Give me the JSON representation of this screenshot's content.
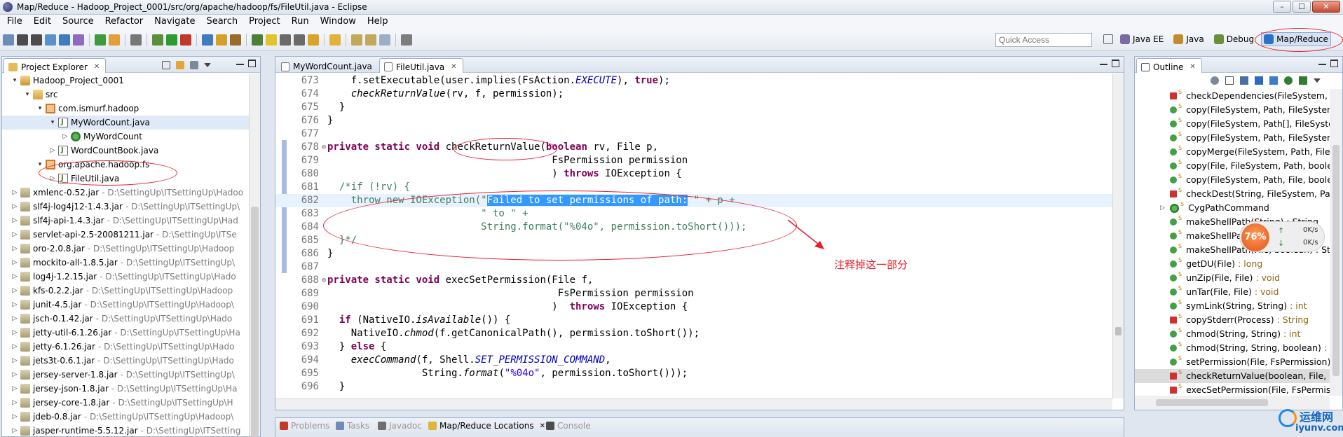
{
  "window": {
    "title": "Map/Reduce - Hadoop_Project_0001/src/org/apache/hadoop/fs/FileUtil.java - Eclipse"
  },
  "menu": [
    "File",
    "Edit",
    "Source",
    "Refactor",
    "Navigate",
    "Search",
    "Project",
    "Run",
    "Window",
    "Help"
  ],
  "toolbar": {
    "quick_access_placeholder": "Quick Access",
    "perspectives": [
      "Java EE",
      "Java",
      "Debug",
      "Map/Reduce"
    ],
    "active_perspective": "Map/Reduce"
  },
  "explorer": {
    "tab": "Project Explorer",
    "nodes": [
      {
        "label": "Hadoop_Project_0001",
        "path": "",
        "indent": 1,
        "arrow": "▾",
        "icon": "project-icon"
      },
      {
        "label": "src",
        "path": "",
        "indent": 2,
        "arrow": "▾",
        "icon": "folder-icon"
      },
      {
        "label": "com.ismurf.hadoop",
        "path": "",
        "indent": 3,
        "arrow": "▾",
        "icon": "package-icon"
      },
      {
        "label": "MyWordCount.java",
        "path": "",
        "indent": 4,
        "arrow": "▾",
        "icon": "java-file-icon",
        "selected": true
      },
      {
        "label": "MyWordCount",
        "path": "",
        "indent": 5,
        "arrow": "▷",
        "icon": "class-icon"
      },
      {
        "label": "WordCountBook.java",
        "path": "",
        "indent": 4,
        "arrow": "▷",
        "icon": "java-file-icon"
      },
      {
        "label": "org.apache.hadoop.fs",
        "path": "",
        "indent": 3,
        "arrow": "▾",
        "icon": "package-icon"
      },
      {
        "label": "FileUtil.java",
        "path": "",
        "indent": 4,
        "arrow": "▷",
        "icon": "java-file-icon"
      },
      {
        "label": "xmlenc-0.52.jar",
        "path": "- D:\\SettingUp\\ITSettingUp\\Hadoo",
        "indent": 1,
        "arrow": "▷",
        "icon": "jar-icon"
      },
      {
        "label": "slf4j-log4j12-1.4.3.jar",
        "path": "- D:\\SettingUp\\ITSettingUp\\",
        "indent": 1,
        "arrow": "▷",
        "icon": "jar-icon"
      },
      {
        "label": "slf4j-api-1.4.3.jar",
        "path": "- D:\\SettingUp\\ITSettingUp\\Had",
        "indent": 1,
        "arrow": "▷",
        "icon": "jar-icon"
      },
      {
        "label": "servlet-api-2.5-20081211.jar",
        "path": "- D:\\SettingUp\\ITSe",
        "indent": 1,
        "arrow": "▷",
        "icon": "jar-icon"
      },
      {
        "label": "oro-2.0.8.jar",
        "path": "- D:\\SettingUp\\ITSettingUp\\Hadoop",
        "indent": 1,
        "arrow": "▷",
        "icon": "jar-icon"
      },
      {
        "label": "mockito-all-1.8.5.jar",
        "path": "- D:\\SettingUp\\ITSettingUp\\",
        "indent": 1,
        "arrow": "▷",
        "icon": "jar-icon"
      },
      {
        "label": "log4j-1.2.15.jar",
        "path": "- D:\\SettingUp\\ITSettingUp\\Hado",
        "indent": 1,
        "arrow": "▷",
        "icon": "jar-icon"
      },
      {
        "label": "kfs-0.2.2.jar",
        "path": "- D:\\SettingUp\\ITSettingUp\\Hadoop",
        "indent": 1,
        "arrow": "▷",
        "icon": "jar-icon"
      },
      {
        "label": "junit-4.5.jar",
        "path": "- D:\\SettingUp\\ITSettingUp\\Hadoop\\",
        "indent": 1,
        "arrow": "▷",
        "icon": "jar-icon"
      },
      {
        "label": "jsch-0.1.42.jar",
        "path": "- D:\\SettingUp\\ITSettingUp\\Hado",
        "indent": 1,
        "arrow": "▷",
        "icon": "jar-icon"
      },
      {
        "label": "jetty-util-6.1.26.jar",
        "path": "- D:\\SettingUp\\ITSettingUp\\Ha",
        "indent": 1,
        "arrow": "▷",
        "icon": "jar-icon"
      },
      {
        "label": "jetty-6.1.26.jar",
        "path": "- D:\\SettingUp\\ITSettingUp\\Hado",
        "indent": 1,
        "arrow": "▷",
        "icon": "jar-icon"
      },
      {
        "label": "jets3t-0.6.1.jar",
        "path": "- D:\\SettingUp\\ITSettingUp\\Hado",
        "indent": 1,
        "arrow": "▷",
        "icon": "jar-icon"
      },
      {
        "label": "jersey-server-1.8.jar",
        "path": "- D:\\SettingUp\\ITSettingUp\\",
        "indent": 1,
        "arrow": "▷",
        "icon": "jar-icon"
      },
      {
        "label": "jersey-json-1.8.jar",
        "path": "- D:\\SettingUp\\ITSettingUp\\Ha",
        "indent": 1,
        "arrow": "▷",
        "icon": "jar-icon"
      },
      {
        "label": "jersey-core-1.8.jar",
        "path": "- D:\\SettingUp\\ITSettingUp\\H",
        "indent": 1,
        "arrow": "▷",
        "icon": "jar-icon"
      },
      {
        "label": "jdeb-0.8.jar",
        "path": "- D:\\SettingUp\\ITSettingUp\\Hadoop\\",
        "indent": 1,
        "arrow": "▷",
        "icon": "jar-icon"
      },
      {
        "label": "jasper-runtime-5.5.12.jar",
        "path": "- D:\\SettingUp\\ITSetting",
        "indent": 1,
        "arrow": "▷",
        "icon": "jar-icon"
      }
    ]
  },
  "editor": {
    "tabs": [
      {
        "label": "MyWordCount.java",
        "active": false
      },
      {
        "label": "FileUtil.java",
        "active": true
      }
    ],
    "lines": [
      {
        "num": "673",
        "html": "    f.setExecutable(user.implies(FsAction.<span class=\"const\">EXECUTE</span>), <span class=\"kw\">true</span>);"
      },
      {
        "num": "674",
        "html": "    <span class=\"it\">checkReturnValue</span>(rv, f, permission);"
      },
      {
        "num": "675",
        "html": "  }"
      },
      {
        "num": "676",
        "html": "}"
      },
      {
        "num": "677",
        "html": ""
      },
      {
        "num": "678",
        "fold": "⊖",
        "html": "<span class=\"kw\">private static void</span> checkReturnValue(<span class=\"kw\">boolean</span> rv, File p,"
      },
      {
        "num": "679",
        "html": "                                      FsPermission permission"
      },
      {
        "num": "680",
        "html": "                                      ) <span class=\"kw\">throws</span> IOException {"
      },
      {
        "num": "681",
        "html": "  <span class=\"cm\">/*if (!rv) {</span>"
      },
      {
        "num": "682",
        "current": true,
        "html": "<span class=\"cm\">    throw new IOException(\"</span><span class=\"sel\">Failed to set permissions of path:</span><span class=\"cm\"> \" + p +</span>"
      },
      {
        "num": "683",
        "html": "<span class=\"cm\">                          \" to \" +</span>"
      },
      {
        "num": "684",
        "html": "<span class=\"cm\">                          String.format(\"%04o\", permission.toShort()));</span>"
      },
      {
        "num": "685",
        "html": "<span class=\"cm\">  }*/</span>"
      },
      {
        "num": "686",
        "html": "}"
      },
      {
        "num": "687",
        "html": ""
      },
      {
        "num": "688",
        "fold": "⊖",
        "html": "<span class=\"kw\">private static void</span> execSetPermission(File f,"
      },
      {
        "num": "689",
        "html": "                                       FsPermission permission"
      },
      {
        "num": "690",
        "html": "                                      )  <span class=\"kw\">throws</span> IOException {"
      },
      {
        "num": "691",
        "html": "  <span class=\"kw\">if</span> (NativeIO.<span class=\"it\">isAvailable</span>()) {"
      },
      {
        "num": "692",
        "html": "    NativeIO.<span class=\"it\">chmod</span>(f.getCanonicalPath(), permission.toShort());"
      },
      {
        "num": "693",
        "html": "  } <span class=\"kw\">else</span> {"
      },
      {
        "num": "694",
        "html": "    <span class=\"it\">execCommand</span>(f, Shell.<span class=\"const\">SET_PERMISSION_COMMAND</span>,"
      },
      {
        "num": "695",
        "html": "                String.<span class=\"it\">format</span>(<span class=\"st\">\"%04o\"</span>, permission.toShort()));"
      },
      {
        "num": "696",
        "html": "  }"
      }
    ]
  },
  "annotation": {
    "note": "注释掉这一部分"
  },
  "outline": {
    "tab": "Outline",
    "items": [
      {
        "label": "checkDependencies(FileSystem, I",
        "vis": "priv",
        "s": true
      },
      {
        "label": "copy(FileSystem, Path, FileSystem",
        "vis": "pub",
        "s": true
      },
      {
        "label": "copy(FileSystem, Path[], FileSyste",
        "vis": "pub",
        "s": true
      },
      {
        "label": "copy(FileSystem, Path, FileSystem",
        "vis": "pub",
        "s": true
      },
      {
        "label": "copyMerge(FileSystem, Path, File",
        "vis": "pub",
        "s": true
      },
      {
        "label": "copy(File, FileSystem, Path, boole",
        "vis": "pub",
        "s": true
      },
      {
        "label": "copy(FileSystem, Path, File, boole",
        "vis": "pub",
        "s": true
      },
      {
        "label": "checkDest(String, FileSystem, Pat",
        "vis": "priv",
        "s": true
      },
      {
        "label": "CygPathCommand",
        "vis": "cls",
        "s": true,
        "arrow": true
      },
      {
        "label": "makeShellPath(String) : String",
        "vis": "pub",
        "s": true
      },
      {
        "label": "makeShellPath(File) : String",
        "vis": "pub",
        "s": true
      },
      {
        "label": "makeShellPath(File, boolean) : St",
        "vis": "pub",
        "s": true
      },
      {
        "label": "getDU(File)",
        "ret": ": long",
        "vis": "pub",
        "s": true
      },
      {
        "label": "unZip(File, File)",
        "ret": ": void",
        "vis": "pub",
        "s": true
      },
      {
        "label": "unTar(File, File)",
        "ret": ": void",
        "vis": "pub",
        "s": true
      },
      {
        "label": "symLink(String, String)",
        "ret": ": int",
        "vis": "pub",
        "s": true
      },
      {
        "label": "copyStderr(Process)",
        "ret": ": String",
        "vis": "priv",
        "s": true
      },
      {
        "label": "chmod(String, String)",
        "ret": ": int",
        "vis": "pub",
        "s": true
      },
      {
        "label": "chmod(String, String, boolean)",
        "ret": ": i",
        "vis": "pub",
        "s": true
      },
      {
        "label": "setPermission(File, FsPermission)",
        "vis": "pub",
        "s": true
      },
      {
        "label": "checkReturnValue(boolean, File,",
        "vis": "priv",
        "s": true,
        "selected": true
      },
      {
        "label": "execSetPermission(File, FsPermis",
        "vis": "priv",
        "s": true
      }
    ]
  },
  "network": {
    "percent": "76%",
    "up": "0K/s",
    "down": "0K/s"
  },
  "bottom_tabs": [
    {
      "label": "Problems",
      "active": false
    },
    {
      "label": "Tasks",
      "active": false
    },
    {
      "label": "Javadoc",
      "active": false
    },
    {
      "label": "Map/Reduce Locations",
      "active": true
    },
    {
      "label": "Console",
      "active": false
    }
  ],
  "watermark": {
    "line1": "运维网",
    "line2": "iyunv.com"
  },
  "colors": {
    "keyword": "#7f0055",
    "comment": "#3f7f5f",
    "string": "#2a00ff",
    "selection": "#3399ff",
    "annotation": "#e8202a"
  }
}
